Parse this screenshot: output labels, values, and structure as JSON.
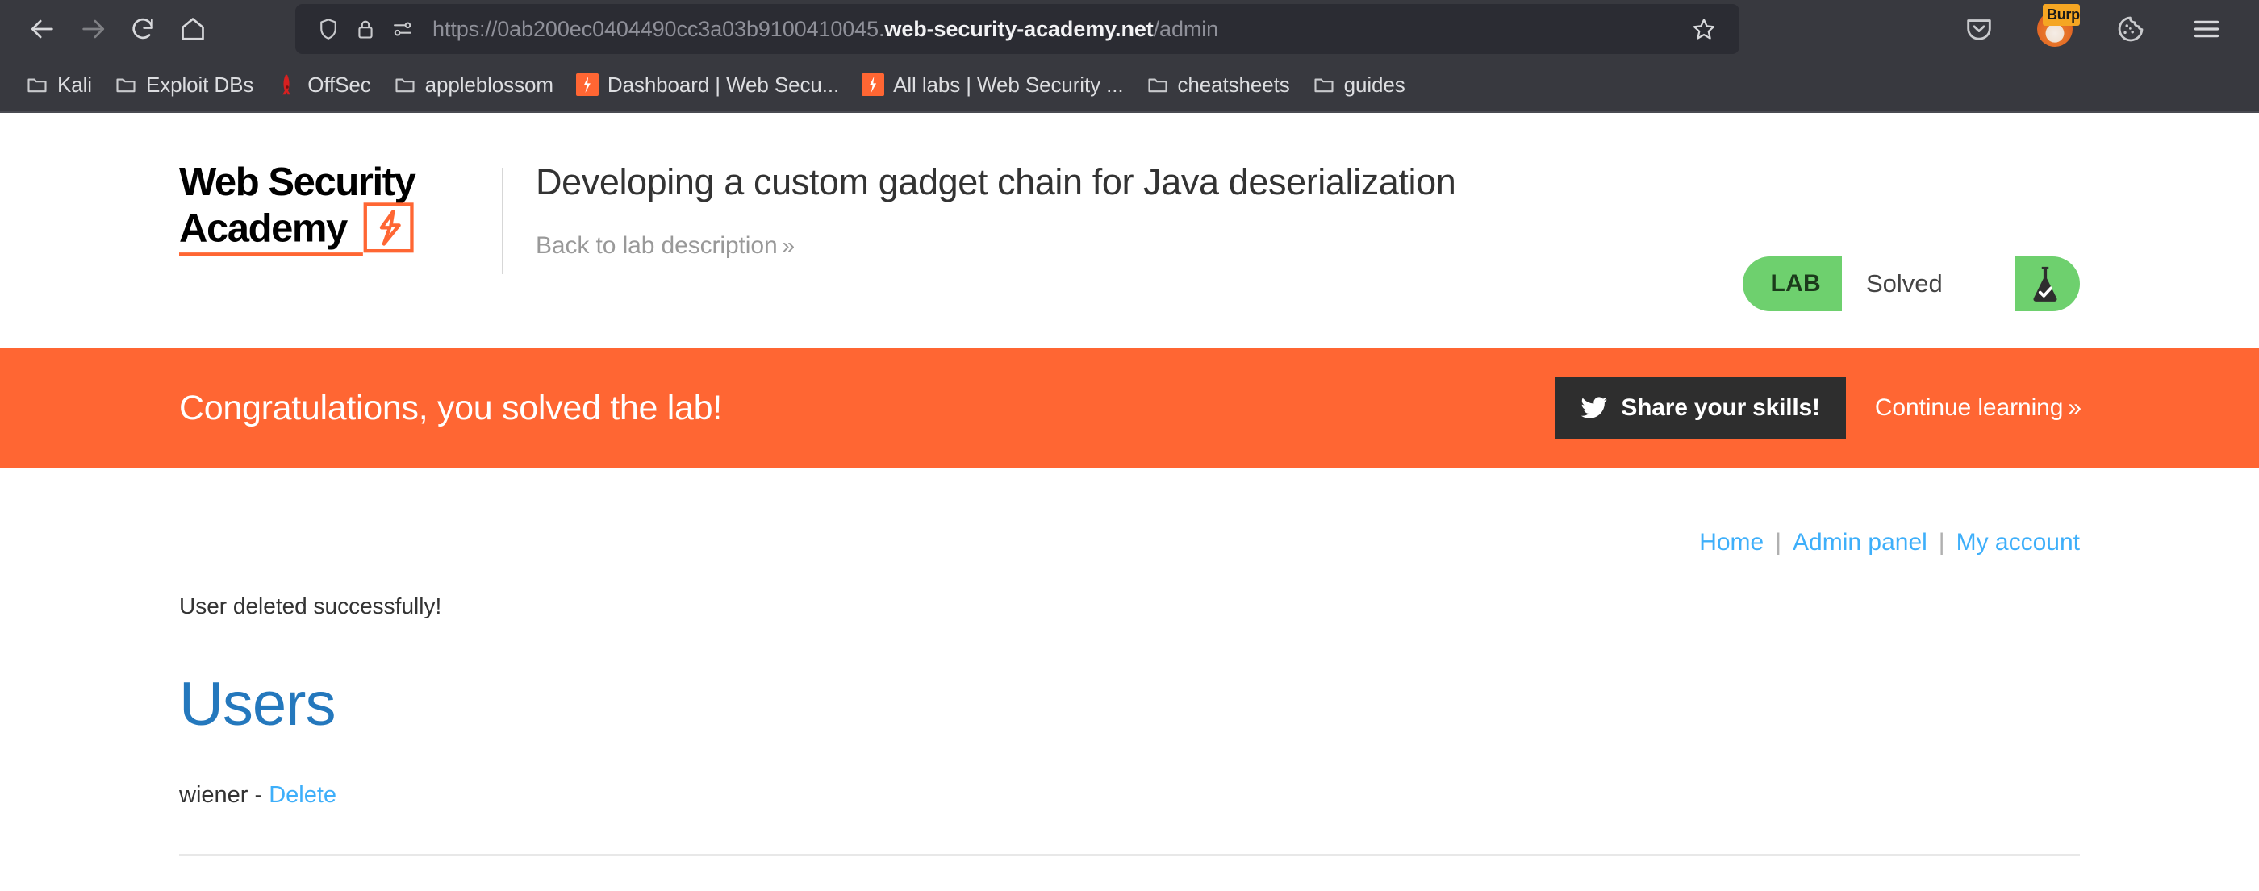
{
  "browser": {
    "nav": {
      "back_icon": "arrow-left-icon",
      "forward_icon": "arrow-right-icon",
      "reload_icon": "reload-icon",
      "home_icon": "home-icon"
    },
    "urlbar": {
      "shield_icon": "shield-icon",
      "lock_icon": "lock-icon",
      "permissions_icon": "site-permissions-icon",
      "scheme": "https://",
      "subdomain": "0ab200ec0404490cc3a03b9100410045.",
      "host": "web-security-academy.net",
      "path": "/admin",
      "full_url": "https://0ab200ec0404490cc3a03b9100410045.web-security-academy.net/admin",
      "bookmark_star_icon": "star-icon"
    },
    "toolbar_right": [
      {
        "name": "pocket-icon",
        "label": ""
      },
      {
        "name": "burp-extension-icon",
        "label": "Burp"
      },
      {
        "name": "cookie-icon",
        "label": ""
      },
      {
        "name": "hamburger-menu-icon",
        "label": ""
      }
    ],
    "bookmarks": [
      {
        "label": "Kali",
        "icon": "folder-icon"
      },
      {
        "label": "Exploit DBs",
        "icon": "folder-icon"
      },
      {
        "label": "OffSec",
        "icon": "offsec-dragon-icon"
      },
      {
        "label": "appleblossom",
        "icon": "folder-icon"
      },
      {
        "label": "Dashboard | Web Secu...",
        "icon": "portswigger-lightning-icon"
      },
      {
        "label": "All labs | Web Security ...",
        "icon": "portswigger-lightning-icon"
      },
      {
        "label": "cheatsheets",
        "icon": "folder-icon"
      },
      {
        "label": "guides",
        "icon": "folder-icon"
      }
    ]
  },
  "academy": {
    "logo_line1": "Web Security",
    "logo_line2": "Academy",
    "lab_title": "Developing a custom gadget chain for Java deserialization",
    "back_link": "Back to lab description",
    "back_link_chevron": "»",
    "status": {
      "lab_word": "LAB",
      "status_text": "Solved",
      "flask_icon": "flask-check-icon",
      "accent_color": "#6ed06e"
    }
  },
  "congrats": {
    "message": "Congratulations, you solved the lab!",
    "share_label": "Share your skills!",
    "share_icon": "twitter-bird-icon",
    "continue_label": "Continue learning",
    "continue_chevron": "»",
    "banner_color": "#ff6633"
  },
  "account_nav": {
    "home": "Home",
    "admin_panel": "Admin panel",
    "my_account": "My account",
    "separator": "|"
  },
  "main": {
    "flash_message": "User deleted successfully!",
    "heading": "Users",
    "users": [
      {
        "name": "wiener",
        "dash": "-",
        "action": "Delete"
      }
    ]
  }
}
